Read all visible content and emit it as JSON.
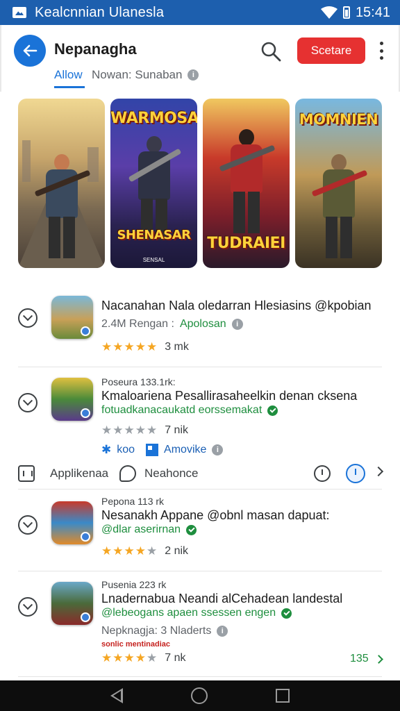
{
  "status_bar": {
    "title": "Kealcnnian Ulanesla",
    "time": "15:41"
  },
  "header": {
    "title": "Nepanagha",
    "primary_button": "Scetare",
    "tab_active": "Allow",
    "tab_meta": "Nowan: Sunaban"
  },
  "gallery": {
    "cards": [
      {
        "title": ""
      },
      {
        "title": "WARMOSA",
        "bottom_title": "SHENASAR",
        "tag": "SENSAL"
      },
      {
        "title": "",
        "bottom_title": "TUDRAIEI"
      },
      {
        "title": "MOMNIEN"
      }
    ]
  },
  "list": {
    "items": [
      {
        "small_label": "",
        "title": "Nacanahan Nala oledarran Hlesiasins @kpobian",
        "subtitle": "2.4M Rengan :",
        "subtitle_accent": "Apolosan",
        "rating": "3 mk",
        "stars": 5
      },
      {
        "small_label": "Poseura 133.1rk:",
        "title": "Kmaloariena Pesallirasaheelkin denan cksena",
        "subtitle": "",
        "subtitle_accent": "fotuadkanacaukatd eorssemakat",
        "rating": "7 nik",
        "stars": 0,
        "quick_actions": [
          {
            "icon": "star-icon",
            "label": "koo"
          },
          {
            "icon": "grid-icon",
            "label": "Amovike"
          }
        ]
      },
      {
        "small_label": "Pepona 113 rk",
        "title": "Nesanakh Appane @obnl masan dapuat:",
        "subtitle": "",
        "subtitle_accent": "@dlar aserirnan",
        "rating": "2 nik",
        "stars": 4
      },
      {
        "small_label": "Pusenia 223 rk",
        "title": "Lnadernabua Neandi alCehadean landestal",
        "subtitle": "",
        "subtitle_accent": "@lebeogans apaen ssessen engen",
        "extra": "Nepknagja: 3 Nladerts",
        "red_note": "sonlic mentinadiac",
        "rating": "7 nk",
        "stars": 4,
        "count": "135"
      }
    ],
    "actions_bar": {
      "label_1": "Applikenaa",
      "label_2": "Neahonce"
    }
  },
  "colors": {
    "brand": "#1d5fae",
    "accent": "#1a73d8",
    "cta": "#e63131",
    "verified": "#1e8e3e",
    "star": "#f5a623"
  }
}
